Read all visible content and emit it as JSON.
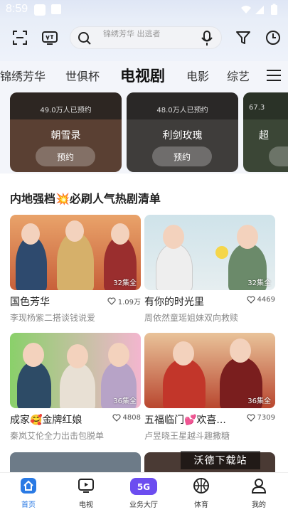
{
  "status": {
    "time": "8:59"
  },
  "header": {
    "search_text": "锦绣芳华 出逃者"
  },
  "tabs": [
    {
      "label": "锦绣芳华"
    },
    {
      "label": "世俱杯"
    },
    {
      "label": "电视剧"
    },
    {
      "label": "电影"
    },
    {
      "label": "综艺"
    }
  ],
  "upcoming": [
    {
      "subtitle": "49.0万人已预约",
      "title": "朝雪录",
      "button": "预约"
    },
    {
      "subtitle": "48.0万人已预约",
      "title": "利剑玫瑰",
      "button": "预约"
    },
    {
      "subtitle": "67.3",
      "title": "超",
      "button": ""
    }
  ],
  "section": {
    "title": "内地强档💥必刷人气热剧清单"
  },
  "shows": [
    {
      "title": "国色芳华",
      "likes": "1.09万",
      "desc": "李现杨紫二搭谈钱说爱",
      "episodes": "32集全"
    },
    {
      "title": "有你的时光里",
      "likes": "4469",
      "desc": "周依然童瑶姐妹双向救赎",
      "episodes": "32集全"
    },
    {
      "title": "成家🥰金牌红娘",
      "likes": "4808",
      "desc": "秦岚艾伦全力出击包脱单",
      "episodes": "36集全"
    },
    {
      "title": "五福临门💕欢喜...",
      "likes": "7309",
      "desc": "卢昱晓王星越斗趣撒糖",
      "episodes": "36集全"
    }
  ],
  "watermark": "沃德下载站",
  "nav": [
    {
      "label": "首页"
    },
    {
      "label": "电视"
    },
    {
      "label": "业务大厅",
      "badge": "5G"
    },
    {
      "label": "体育"
    },
    {
      "label": "我的"
    }
  ],
  "colors": {
    "accent": "#2a7ae4",
    "nav_badge": "#6c4df0"
  }
}
